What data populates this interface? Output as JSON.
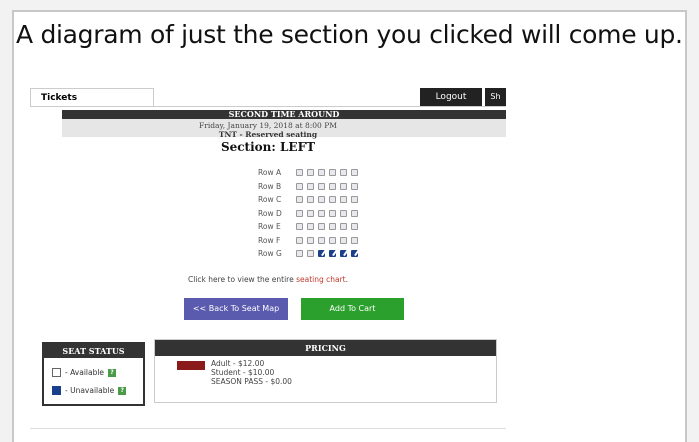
{
  "caption": "A diagram of just the section you clicked will come up.",
  "tabs": {
    "tickets": "Tickets",
    "logout": "Logout",
    "partial": "Sh"
  },
  "event": {
    "title": "SECOND TIME AROUND",
    "date": "Friday, January 19, 2018 at 8:00 PM",
    "seating": "TNT - Reserved seating",
    "section": "Section: LEFT"
  },
  "rows": [
    {
      "label": "Row A",
      "seats": [
        "available",
        "available",
        "available",
        "available",
        "available",
        "available"
      ]
    },
    {
      "label": "Row B",
      "seats": [
        "available",
        "available",
        "available",
        "available",
        "available",
        "available"
      ]
    },
    {
      "label": "Row C",
      "seats": [
        "available",
        "available",
        "available",
        "available",
        "available",
        "available"
      ]
    },
    {
      "label": "Row D",
      "seats": [
        "available",
        "available",
        "available",
        "available",
        "available",
        "available"
      ]
    },
    {
      "label": "Row E",
      "seats": [
        "available",
        "available",
        "available",
        "available",
        "available",
        "available"
      ]
    },
    {
      "label": "Row F",
      "seats": [
        "available",
        "available",
        "available",
        "available",
        "available",
        "available"
      ]
    },
    {
      "label": "Row G",
      "seats": [
        "available",
        "available",
        "unavailable",
        "unavailable",
        "unavailable",
        "unavailable"
      ]
    }
  ],
  "click_text": "Click here to view the entire ",
  "click_link": "seating chart",
  "click_end": ".",
  "buttons": {
    "back": "<< Back To Seat Map",
    "cart": "Add To Cart"
  },
  "status": {
    "title": "SEAT STATUS",
    "available": "- Available",
    "unavailable": "- Unavailable",
    "help": "?"
  },
  "pricing": {
    "title": "PRICING",
    "items": [
      "Adult - $12.00",
      "Student - $10.00",
      "SEASON PASS - $0.00"
    ],
    "swatch_color": "#8b1a1a"
  }
}
